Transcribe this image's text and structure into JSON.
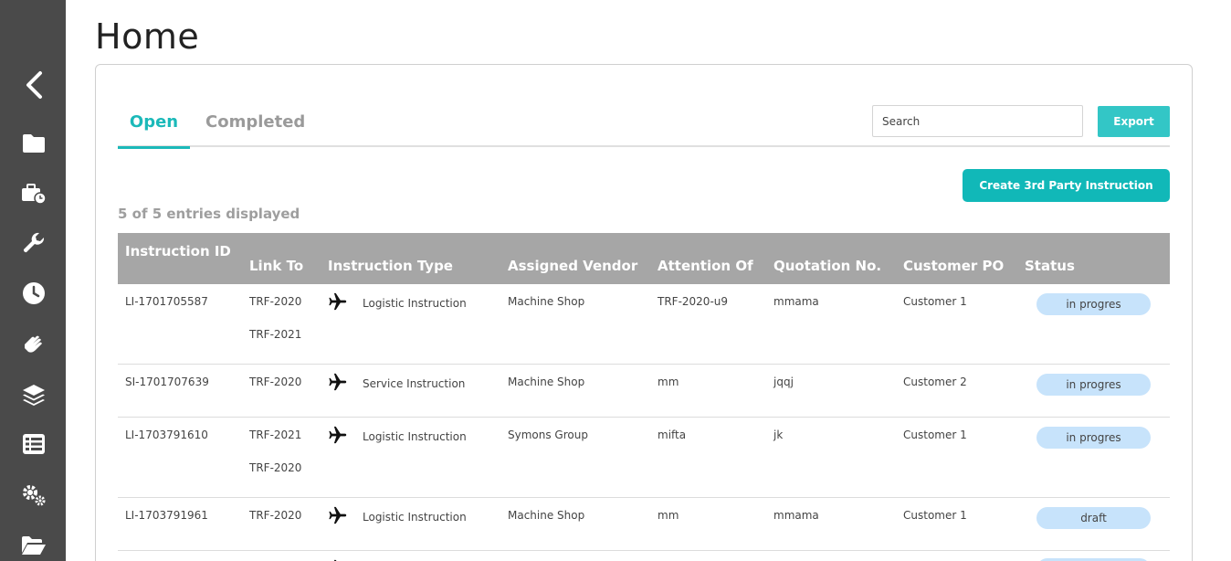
{
  "page": {
    "title": "Home"
  },
  "sidebar": {
    "items": [
      {
        "icon": "chevron-left-icon"
      },
      {
        "icon": "folder-icon"
      },
      {
        "icon": "briefcase-clock-icon"
      },
      {
        "icon": "wrench-icon"
      },
      {
        "icon": "clock-icon"
      },
      {
        "icon": "hands-icon"
      },
      {
        "icon": "layers-icon"
      },
      {
        "icon": "table-list-icon"
      },
      {
        "icon": "gears-icon"
      },
      {
        "icon": "folder-open-icon"
      }
    ]
  },
  "tabs": [
    {
      "label": "Open",
      "active": true
    },
    {
      "label": "Completed",
      "active": false
    }
  ],
  "search": {
    "placeholder": "Search",
    "value": ""
  },
  "buttons": {
    "export": "Export",
    "create": "Create 3rd Party Instruction"
  },
  "entries_text": "5 of 5 entries displayed",
  "table": {
    "headers": [
      "Instruction ID",
      "Link To",
      "Instruction Type",
      "Assigned Vendor",
      "Attention Of",
      "Quotation No.",
      "Customer PO",
      "Status"
    ],
    "rows": [
      {
        "id": "LI-1701705587",
        "links": [
          "TRF-2020",
          "TRF-2021"
        ],
        "type": "Logistic Instruction",
        "vendor": "Machine Shop",
        "attention": "TRF-2020-u9",
        "quotation": "mmama",
        "po": "Customer 1",
        "status": "in progres"
      },
      {
        "id": "SI-1701707639",
        "links": [
          "TRF-2020"
        ],
        "type": "Service Instruction",
        "vendor": "Machine Shop",
        "attention": "mm",
        "quotation": "jqqj",
        "po": "Customer 2",
        "status": "in progres"
      },
      {
        "id": "LI-1703791610",
        "links": [
          "TRF-2021",
          "TRF-2020"
        ],
        "type": "Logistic Instruction",
        "vendor": "Symons Group",
        "attention": "mifta",
        "quotation": "jk",
        "po": "Customer 1",
        "status": "in progres"
      },
      {
        "id": "LI-1703791961",
        "links": [
          "TRF-2020"
        ],
        "type": "Logistic Instruction",
        "vendor": "Machine Shop",
        "attention": "mm",
        "quotation": "mmama",
        "po": "Customer 1",
        "status": "draft"
      }
    ]
  },
  "colors": {
    "accent": "#1bb9b9",
    "sidebar": "#4a4a4a",
    "header": "#a6a6a6",
    "badge": "#c7e3fb"
  }
}
